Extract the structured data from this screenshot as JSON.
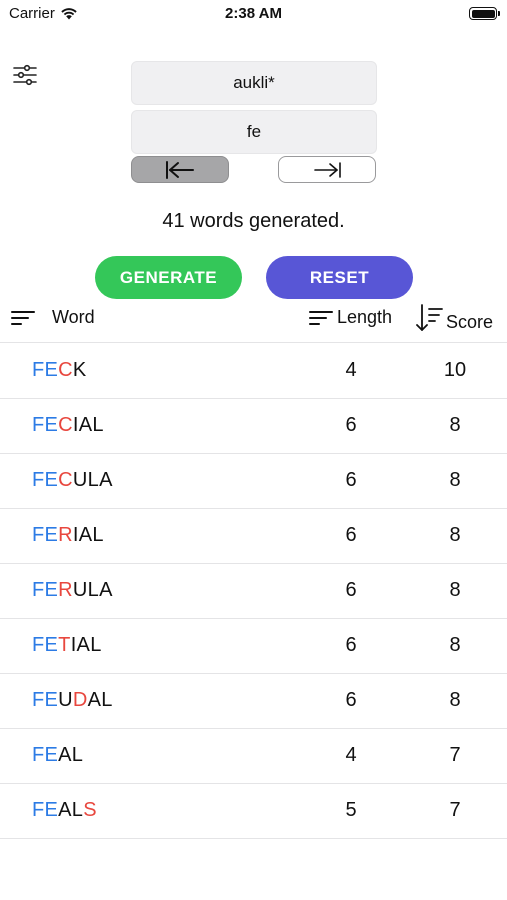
{
  "status_bar": {
    "carrier": "Carrier",
    "time": "2:38 AM"
  },
  "icons": {
    "filter": "sliders-icon",
    "align_left": "arrow-to-left-bar-icon",
    "align_right": "arrow-to-right-bar-icon",
    "sort": "sort-lines-icon",
    "sort_desc": "sort-descending-icon",
    "wifi": "wifi-icon",
    "battery": "battery-icon"
  },
  "inputs": {
    "letters": "aukli*",
    "prefix": "fe"
  },
  "status_text": "41 words generated.",
  "buttons": {
    "generate": "GENERATE",
    "reset": "RESET"
  },
  "colors": {
    "generate": "#34c759",
    "reset": "#5856d6",
    "prefix_letters": "#2c7be5",
    "wildcard_letters": "#e8473e"
  },
  "table": {
    "columns": {
      "word": "Word",
      "length": "Length",
      "score": "Score"
    },
    "rows": [
      {
        "parts": [
          {
            "t": "FE",
            "c": "blue"
          },
          {
            "t": "C",
            "c": "red"
          },
          {
            "t": "K",
            "c": "dark"
          }
        ],
        "length": "4",
        "score": "10"
      },
      {
        "parts": [
          {
            "t": "FE",
            "c": "blue"
          },
          {
            "t": "C",
            "c": "red"
          },
          {
            "t": "IAL",
            "c": "dark"
          }
        ],
        "length": "6",
        "score": "8"
      },
      {
        "parts": [
          {
            "t": "FE",
            "c": "blue"
          },
          {
            "t": "C",
            "c": "red"
          },
          {
            "t": "ULA",
            "c": "dark"
          }
        ],
        "length": "6",
        "score": "8"
      },
      {
        "parts": [
          {
            "t": "FE",
            "c": "blue"
          },
          {
            "t": "R",
            "c": "red"
          },
          {
            "t": "IAL",
            "c": "dark"
          }
        ],
        "length": "6",
        "score": "8"
      },
      {
        "parts": [
          {
            "t": "FE",
            "c": "blue"
          },
          {
            "t": "R",
            "c": "red"
          },
          {
            "t": "ULA",
            "c": "dark"
          }
        ],
        "length": "6",
        "score": "8"
      },
      {
        "parts": [
          {
            "t": "FE",
            "c": "blue"
          },
          {
            "t": "T",
            "c": "red"
          },
          {
            "t": "IAL",
            "c": "dark"
          }
        ],
        "length": "6",
        "score": "8"
      },
      {
        "parts": [
          {
            "t": "FE",
            "c": "blue"
          },
          {
            "t": "U",
            "c": "dark"
          },
          {
            "t": "D",
            "c": "red"
          },
          {
            "t": "AL",
            "c": "dark"
          }
        ],
        "length": "6",
        "score": "8"
      },
      {
        "parts": [
          {
            "t": "FE",
            "c": "blue"
          },
          {
            "t": "AL",
            "c": "dark"
          }
        ],
        "length": "4",
        "score": "7"
      },
      {
        "parts": [
          {
            "t": "FE",
            "c": "blue"
          },
          {
            "t": "AL",
            "c": "dark"
          },
          {
            "t": "S",
            "c": "red"
          }
        ],
        "length": "5",
        "score": "7"
      }
    ]
  }
}
